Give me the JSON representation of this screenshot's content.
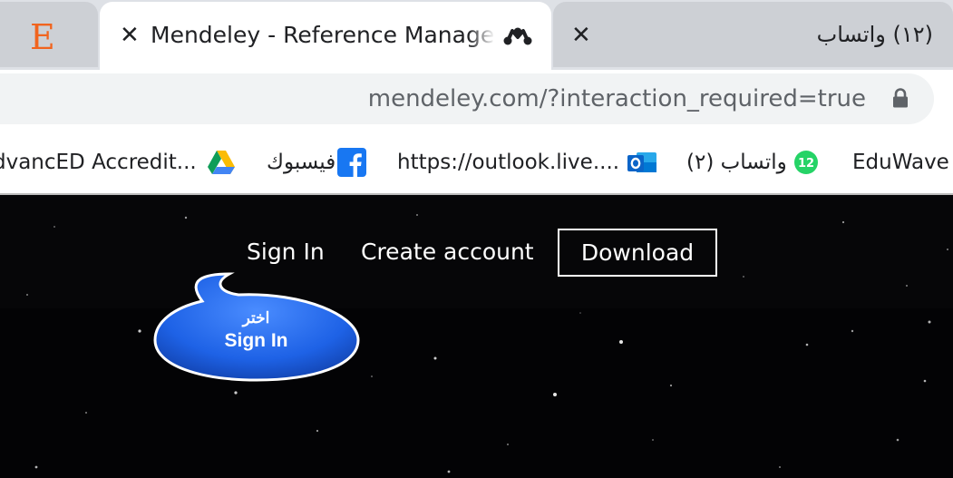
{
  "tabs": {
    "etsy": {
      "icon": "etsy-icon",
      "icon_letter": "E"
    },
    "active": {
      "title": "Mendeley - Reference Managem",
      "close": "✕",
      "icon": "mendeley-icon"
    },
    "whatsapp": {
      "title": "(١٢) واتساب",
      "close": "✕"
    }
  },
  "address_bar": {
    "url": "mendeley.com/?interaction_required=true",
    "icon": "lock-icon"
  },
  "bookmarks": [
    {
      "label": "dvancED Accredit...",
      "icon": "google-drive-icon"
    },
    {
      "label": "فيسبوك",
      "icon": "facebook-icon"
    },
    {
      "label": "https://outlook.live....",
      "icon": "outlook-icon"
    },
    {
      "label": "(٢) واتساب",
      "icon": "whatsapp-badge-icon",
      "badge": "12"
    },
    {
      "label": "EduWave"
    }
  ],
  "site_nav": {
    "sign_in": "Sign In",
    "create_account": "Create account",
    "download": "Download"
  },
  "callout": {
    "arabic": "اختر",
    "english": "Sign In",
    "color": "#1e62e6"
  },
  "colors": {
    "etsy": "#f1641e",
    "facebook": "#1877f2",
    "outlook": "#0a64c8",
    "whatsapp_badge": "#25d366"
  }
}
